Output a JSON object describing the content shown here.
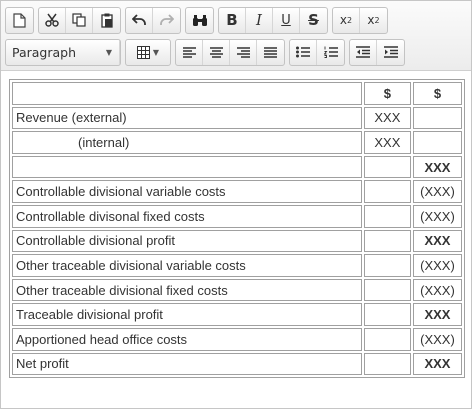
{
  "toolbar": {
    "row1": [
      {
        "name": "new-document-icon",
        "glyph": "🗋"
      },
      {
        "name": "cut-icon",
        "glyph": "✂"
      },
      {
        "name": "copy-icon",
        "glyph": "⧉"
      },
      {
        "name": "paste-icon",
        "glyph": "📋"
      },
      {
        "name": "undo-icon",
        "glyph": "↶"
      },
      {
        "name": "redo-icon",
        "glyph": "↷"
      },
      {
        "name": "find-icon",
        "glyph": "🔍"
      },
      {
        "name": "bold-button",
        "label": "B"
      },
      {
        "name": "italic-button",
        "label": "I"
      },
      {
        "name": "underline-button",
        "label": "U"
      },
      {
        "name": "strikethrough-button",
        "label": "S"
      },
      {
        "name": "subscript-button",
        "label": "x"
      },
      {
        "name": "superscript-button",
        "label": "x"
      }
    ],
    "format_select": "Paragraph",
    "row2_icons": [
      "table-icon",
      "align-left-icon",
      "align-center-icon",
      "align-right-icon",
      "align-justify-icon",
      "bullet-list-icon",
      "numbered-list-icon",
      "outdent-icon",
      "indent-icon"
    ]
  },
  "table": {
    "header": [
      "",
      "$",
      "$"
    ],
    "rows": [
      {
        "label": "Revenue (external)",
        "c1": "XXX",
        "c2": ""
      },
      {
        "label": "(internal)",
        "c1": "XXX",
        "c2": ""
      },
      {
        "label": "",
        "c1": "",
        "c2": "XXX"
      },
      {
        "label": "Controllable divisional variable costs",
        "c1": "",
        "c2": "(XXX)"
      },
      {
        "label": "Controllable divisonal fixed costs",
        "c1": "",
        "c2": "(XXX)"
      },
      {
        "label": "Controllable divisional profit",
        "c1": "",
        "c2": "XXX"
      },
      {
        "label": "Other traceable divisional variable costs",
        "c1": "",
        "c2": "(XXX)"
      },
      {
        "label": "Other traceable divisional fixed costs",
        "c1": "",
        "c2": "(XXX)"
      },
      {
        "label": "Traceable divisional profit",
        "c1": "",
        "c2": "XXX"
      },
      {
        "label": "Apportioned head office costs",
        "c1": "",
        "c2": "(XXX)"
      },
      {
        "label": "Net profit",
        "c1": "",
        "c2": "XXX"
      }
    ]
  }
}
